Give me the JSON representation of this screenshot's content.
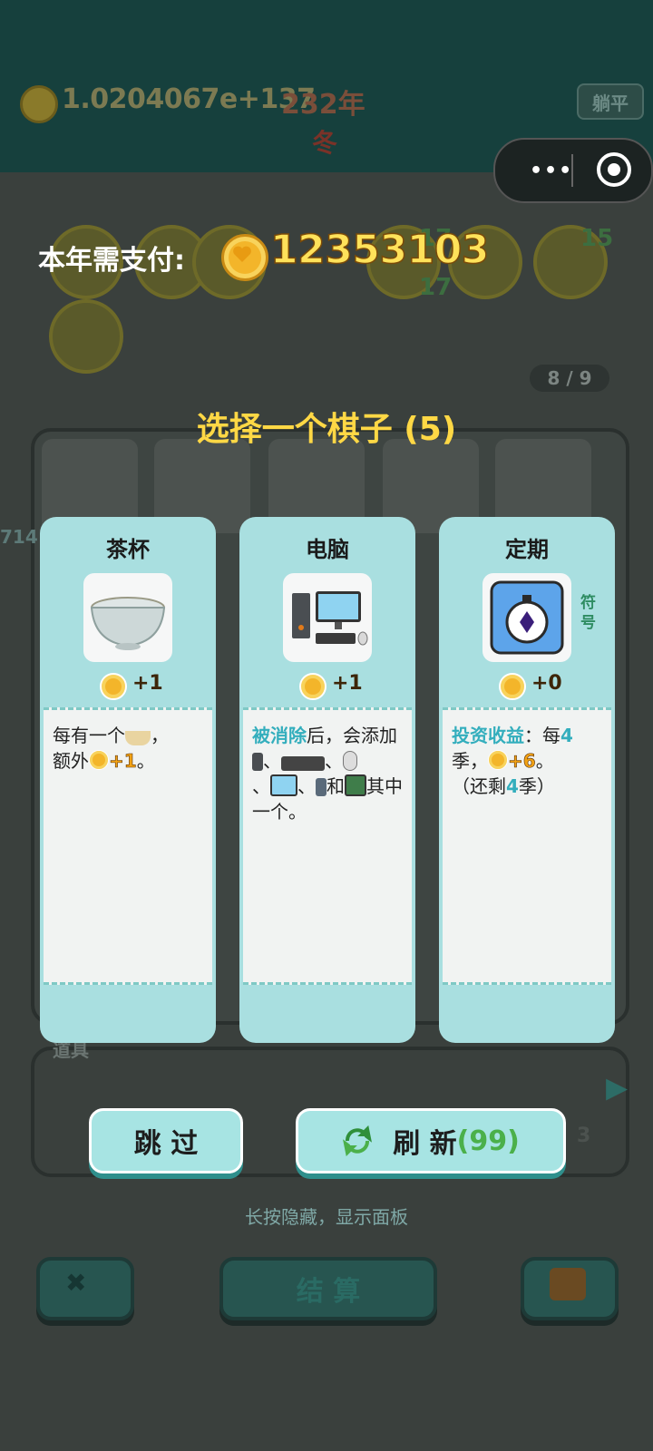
{
  "background": {
    "money": "1.0204067e+137",
    "year": "232年",
    "season": "冬",
    "flat_button": "躺平",
    "page_indicator": "8 / 9",
    "top_counts": [
      "17",
      "17",
      "15"
    ],
    "board_side_number": "714",
    "items_label": "道具",
    "item_counts": [
      "3"
    ],
    "bottom_buttons": {
      "settle": "结 算"
    }
  },
  "overlay": {
    "pay_label": "本年需支付:",
    "pay_amount": "12353103",
    "choose_title": "选择一个棋子 (5)",
    "hint": "长按隐藏，显示面板"
  },
  "cards": [
    {
      "name": "茶杯",
      "coin_value": "+1",
      "icon": "tea-bowl-icon",
      "desc": {
        "t1": "每有一个",
        "t2": "，",
        "t3": "额外",
        "t4": "+1",
        "t5": "。"
      }
    },
    {
      "name": "电脑",
      "coin_value": "+1",
      "icon": "computer-icon",
      "desc": {
        "t1": "被消除",
        "t2": "后，会添加",
        "t3": "、",
        "t4": "、",
        "t5": "、",
        "t6": "、",
        "t7": "和",
        "t8": "其中一个。"
      }
    },
    {
      "name": "定期",
      "tag": "符号",
      "coin_value": "+0",
      "icon": "stopwatch-icon",
      "desc": {
        "t1": "投资收益",
        "t2": "：每",
        "t3": "4",
        "t4": "季，",
        "t5": "+6",
        "t6": "。",
        "t7": "（还剩",
        "t8": "4",
        "t9": "季）"
      }
    }
  ],
  "buttons": {
    "skip": "跳 过",
    "refresh": "刷 新",
    "refresh_count": "(99)"
  },
  "colors": {
    "title_yellow": "#ffd845",
    "card_teal": "#a9dfe0",
    "highlight": "#33aebd",
    "refresh_count": "#4bb04a"
  }
}
